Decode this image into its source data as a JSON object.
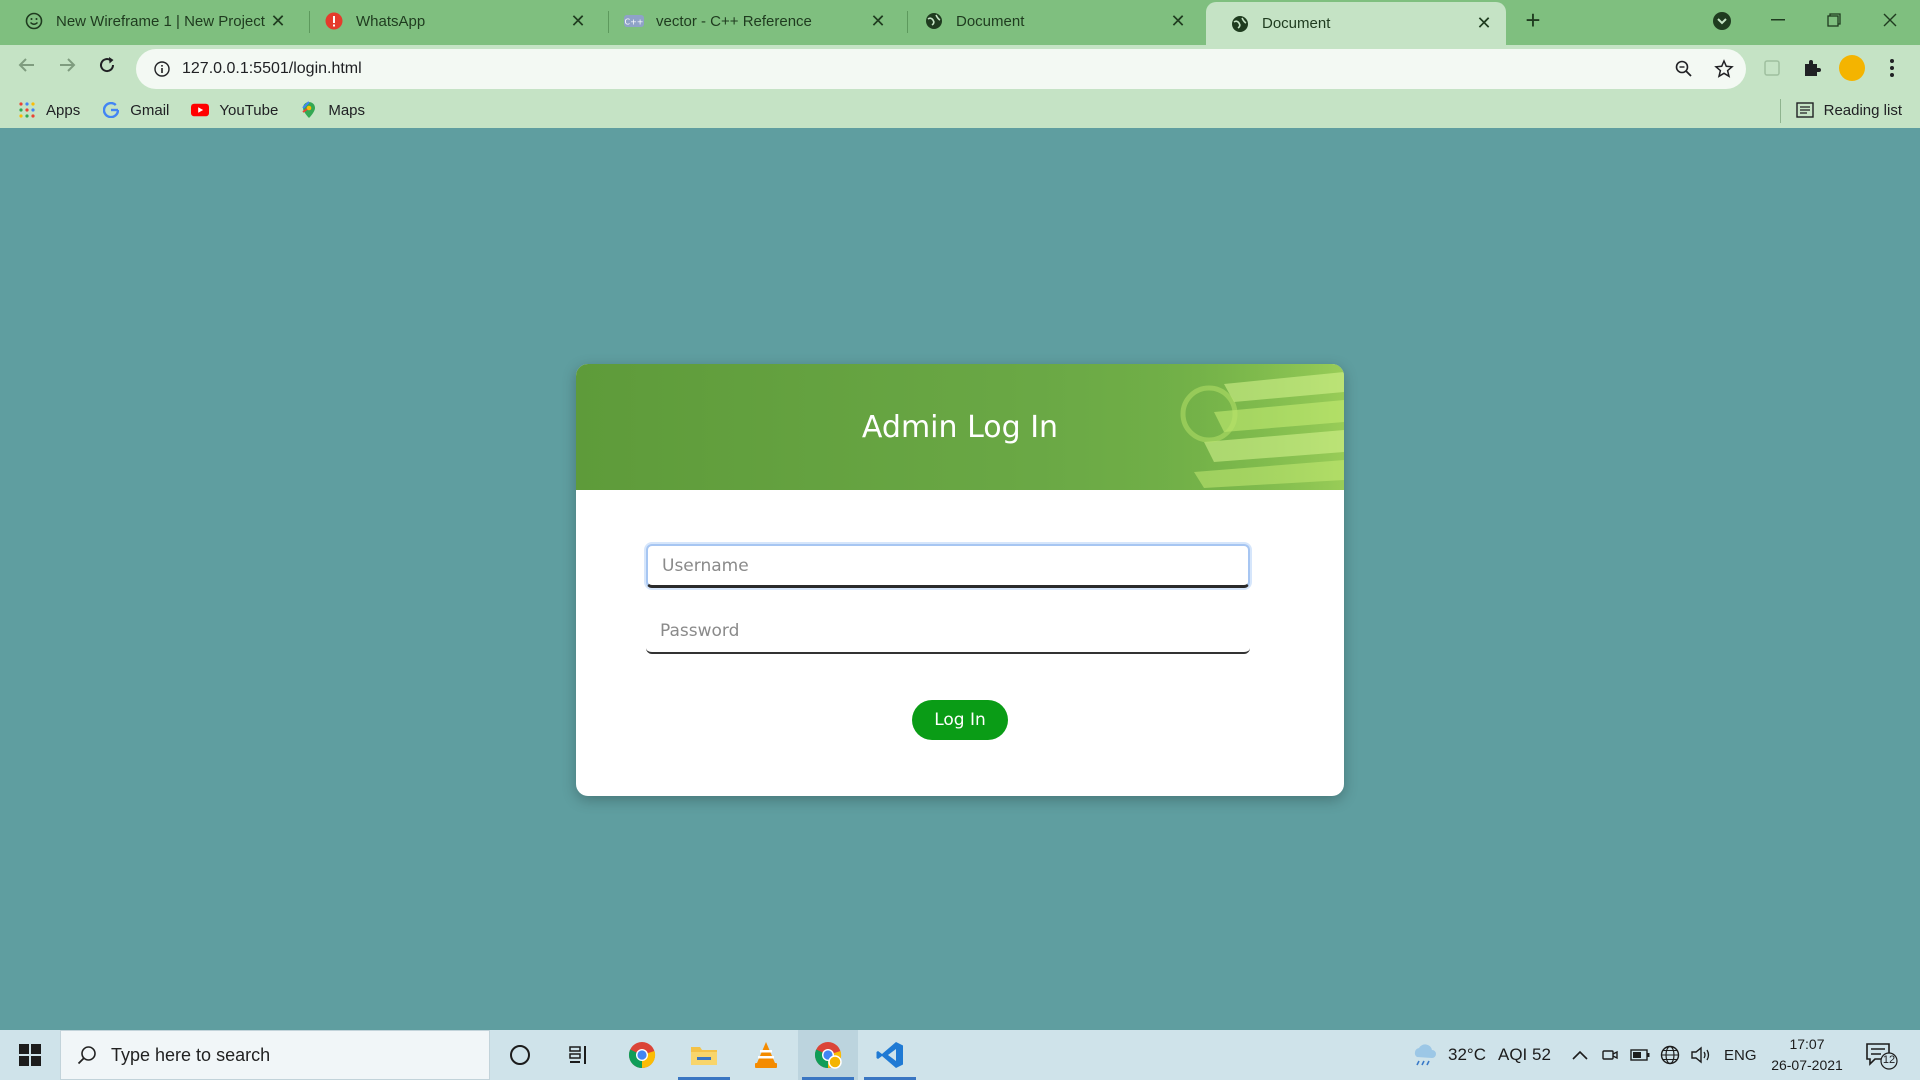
{
  "browser": {
    "tabs": [
      {
        "title": "New Wireframe 1 | New Project |",
        "favicon": "smiley-icon"
      },
      {
        "title": "WhatsApp",
        "favicon": "whatsapp-alert-icon"
      },
      {
        "title": "vector - C++ Reference",
        "favicon": "cplusplus-icon"
      },
      {
        "title": "Document",
        "favicon": "globe-icon"
      },
      {
        "title": "Document",
        "favicon": "globe-icon",
        "active": true
      }
    ],
    "url": "127.0.0.1:5501/login.html",
    "bookmarks": [
      {
        "label": "Apps",
        "icon": "apps-grid-icon"
      },
      {
        "label": "Gmail",
        "icon": "google-icon"
      },
      {
        "label": "YouTube",
        "icon": "youtube-icon"
      },
      {
        "label": "Maps",
        "icon": "maps-icon"
      }
    ],
    "reading_list": "Reading list"
  },
  "page": {
    "header_title": "Admin Log In",
    "username_placeholder": "Username",
    "password_placeholder": "Password",
    "login_label": "Log In",
    "colors": {
      "background": "#5f9ea0",
      "header": "#6aa845",
      "button": "#0a9c16"
    }
  },
  "taskbar": {
    "search_placeholder": "Type here to search",
    "weather": "32°C",
    "aqi": "AQI 52",
    "language": "ENG",
    "time": "17:07",
    "date": "26-07-2021",
    "notifications": "12"
  }
}
